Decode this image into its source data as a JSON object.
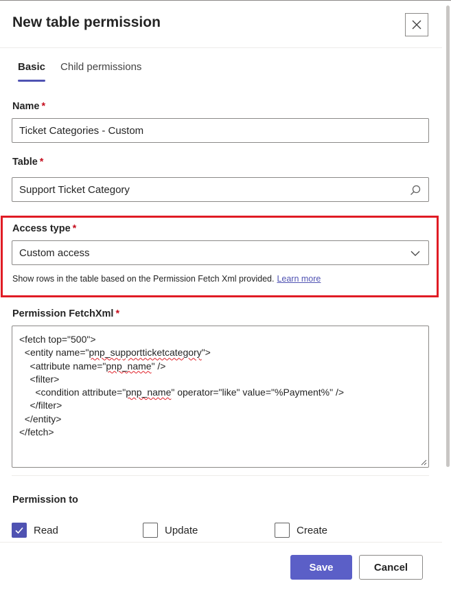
{
  "panel": {
    "title": "New table permission",
    "close_label": "×"
  },
  "tabs": [
    {
      "label": "Basic",
      "active": true
    },
    {
      "label": "Child permissions",
      "active": false
    }
  ],
  "required_marker": "*",
  "name": {
    "label": "Name",
    "value": "Ticket Categories - Custom"
  },
  "table": {
    "label": "Table",
    "value": "Support Ticket Category",
    "icon": "search-icon"
  },
  "access_type": {
    "label": "Access type",
    "value": "Custom access",
    "icon": "chevron-down-icon",
    "helper_text": "Show rows in the table based on the Permission Fetch Xml provided.",
    "learn_more": "Learn more"
  },
  "fetchxml": {
    "label": "Permission FetchXml",
    "lines": [
      {
        "pre": "<fetch top=\"500\">",
        "err": "",
        "post": ""
      },
      {
        "pre": "  <entity name=\"",
        "err": "pnp_supportticketcategory",
        "post": "\">"
      },
      {
        "pre": "    <attribute name=\"",
        "err": "pnp_name",
        "post": "\" />"
      },
      {
        "pre": "    <filter>",
        "err": "",
        "post": ""
      },
      {
        "pre": "      <condition attribute=\"",
        "err": "pnp_name",
        "post": "\" operator=\"like\" value=\"%Payment%\" />"
      },
      {
        "pre": "    </filter>",
        "err": "",
        "post": ""
      },
      {
        "pre": "  </entity>",
        "err": "",
        "post": ""
      },
      {
        "pre": "</fetch>",
        "err": "",
        "post": ""
      }
    ]
  },
  "permission_to": {
    "label": "Permission to",
    "options": [
      {
        "label": "Read",
        "checked": true
      },
      {
        "label": "Update",
        "checked": false
      },
      {
        "label": "Create",
        "checked": false
      }
    ]
  },
  "footer": {
    "save_label": "Save",
    "cancel_label": "Cancel"
  },
  "colors": {
    "accent": "#5b5fc7",
    "highlight": "#e01b24",
    "required": "#c50f1f"
  }
}
